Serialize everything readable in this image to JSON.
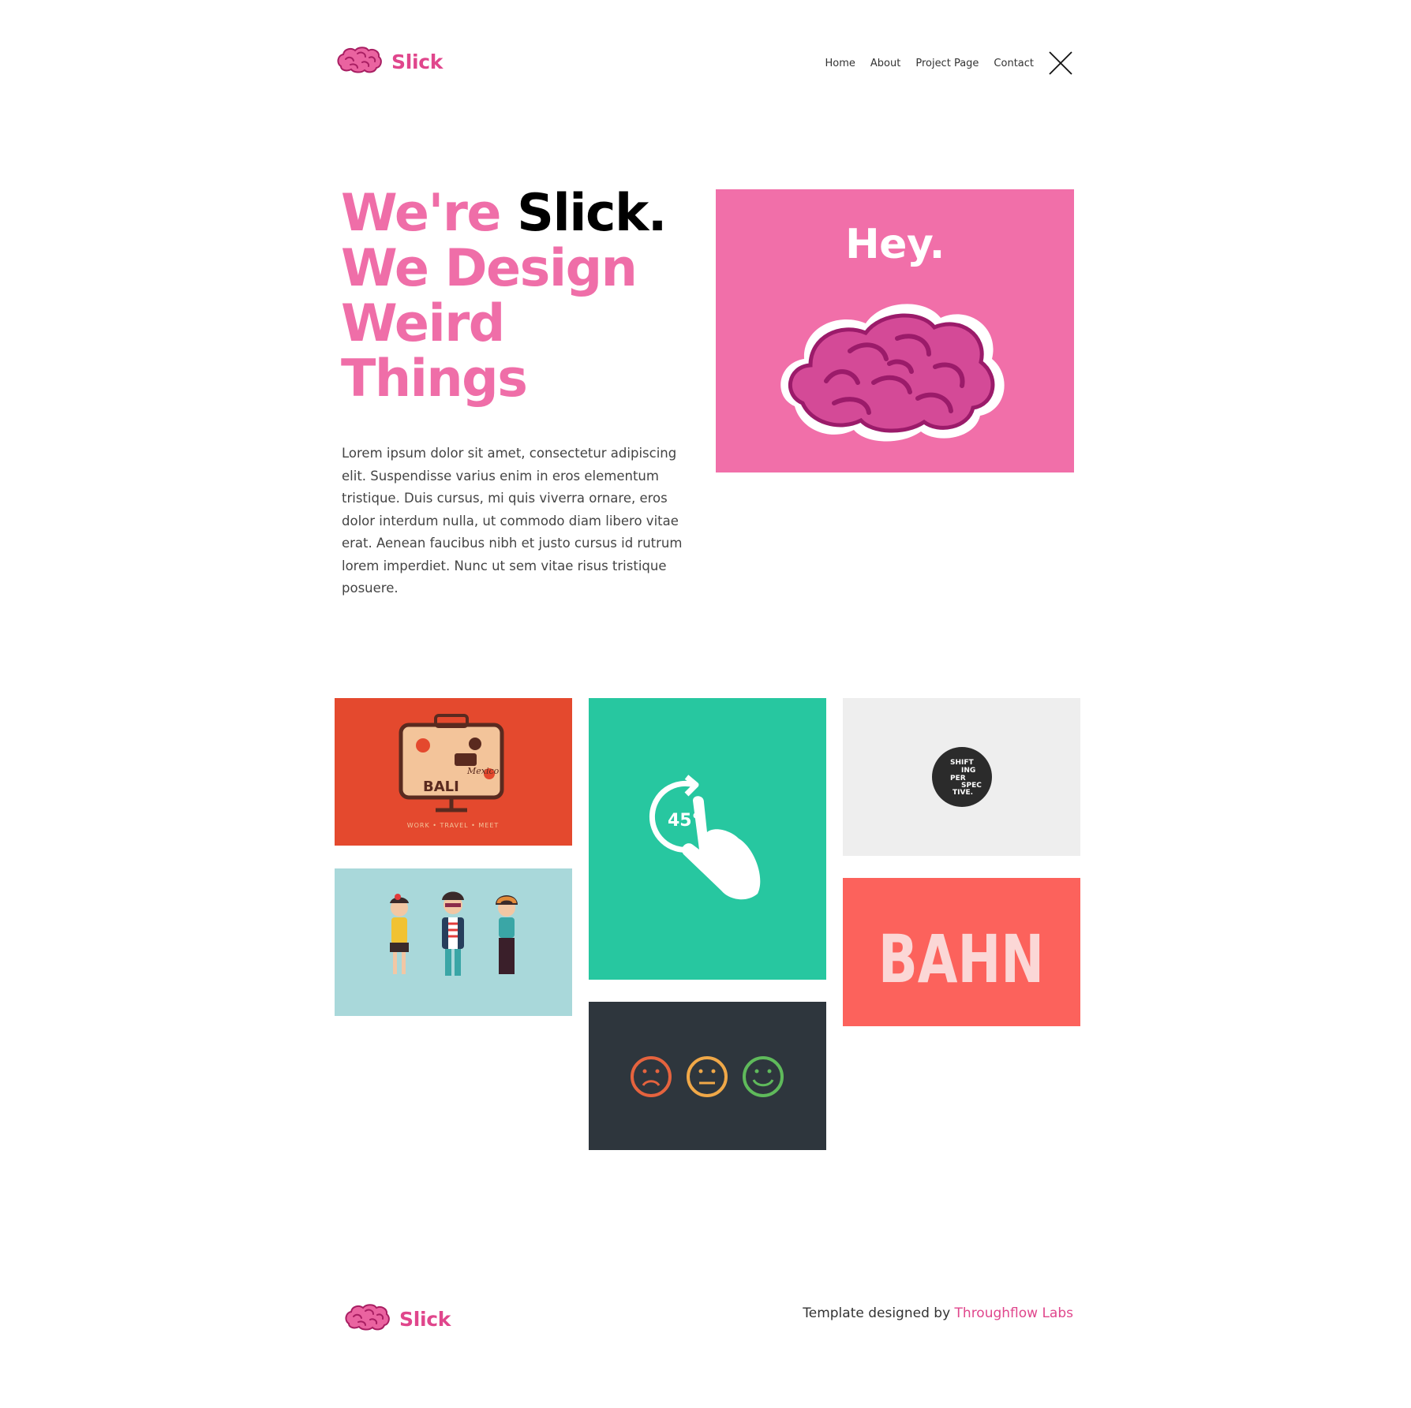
{
  "brand": {
    "name": "Slick",
    "accent_color": "#e0468c",
    "icon": "brain-icon"
  },
  "nav": {
    "items": [
      {
        "label": "Home"
      },
      {
        "label": "About"
      },
      {
        "label": "Project Page"
      },
      {
        "label": "Contact"
      }
    ],
    "menu_icon": "close-icon"
  },
  "hero": {
    "title_pre": "We're ",
    "title_highlight": "Slick.",
    "title_rest": "We Design Weird Things",
    "paragraph": "Lorem ipsum dolor sit amet, consectetur adipiscing elit. Suspendisse varius enim in eros elementum tristique. Duis cursus, mi quis viverra ornare, eros dolor interdum nulla, ut commodo diam libero vitae erat. Aenean faucibus nibh et justo cursus id rutrum lorem imperdiet. Nunc ut sem vitae risus tristique posuere.",
    "card": {
      "title": "Hey.",
      "background": "#f16fa9"
    }
  },
  "gallery": {
    "items": [
      {
        "name": "travel-suitcase",
        "background": "#e4492e",
        "labels": [
          "BALI",
          "Mexico",
          "WORK • TRAVEL • MEET"
        ]
      },
      {
        "name": "rotate-gesture",
        "background": "#27c7a0",
        "label": "45°"
      },
      {
        "name": "shifting-perspective",
        "background": "#eeeeee",
        "lines": [
          "SHIFT",
          "ING",
          "PER",
          "SPEC",
          "TIVE."
        ]
      },
      {
        "name": "hipster-characters",
        "background": "#a9d8da"
      },
      {
        "name": "bahn-logo",
        "background": "#fc625c",
        "label": "BAHN"
      },
      {
        "name": "feedback-faces",
        "background": "#2e363d",
        "face_colors": [
          "#e5633e",
          "#f0a848",
          "#5fba5b"
        ]
      }
    ]
  },
  "footer": {
    "credit_prefix": "Template designed by ",
    "credit_link": "Throughflow Labs"
  }
}
